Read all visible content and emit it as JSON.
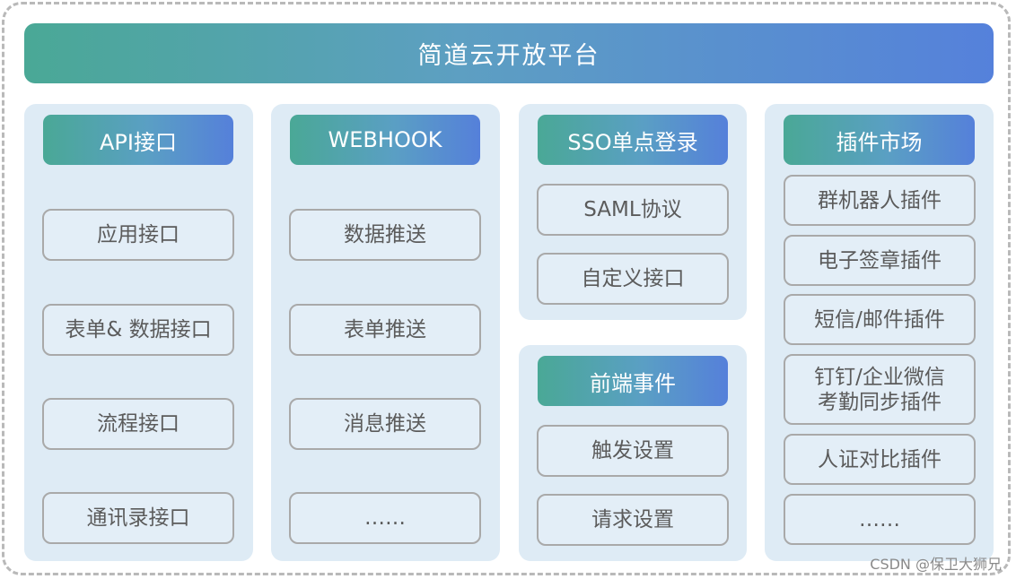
{
  "title": "简道云开放平台",
  "columns": {
    "api": {
      "header": "API接口",
      "items": [
        "应用接口",
        "表单& 数据接口",
        "流程接口",
        "通讯录接口"
      ]
    },
    "webhook": {
      "header": "WEBHOOK",
      "items": [
        "数据推送",
        "表单推送",
        "消息推送",
        "……"
      ]
    },
    "sso": {
      "header": "SSO单点登录",
      "items": [
        "SAML协议",
        "自定义接口"
      ]
    },
    "frontend": {
      "header": "前端事件",
      "items": [
        "触发设置",
        "请求设置"
      ]
    },
    "plugins": {
      "header": "插件市场",
      "items": [
        "群机器人插件",
        "电子签章插件",
        "短信/邮件插件",
        "钉钉/企业微信",
        "考勤同步插件",
        "人证对比插件",
        "……"
      ]
    }
  },
  "watermark": "CSDN @保卫大狮兄"
}
